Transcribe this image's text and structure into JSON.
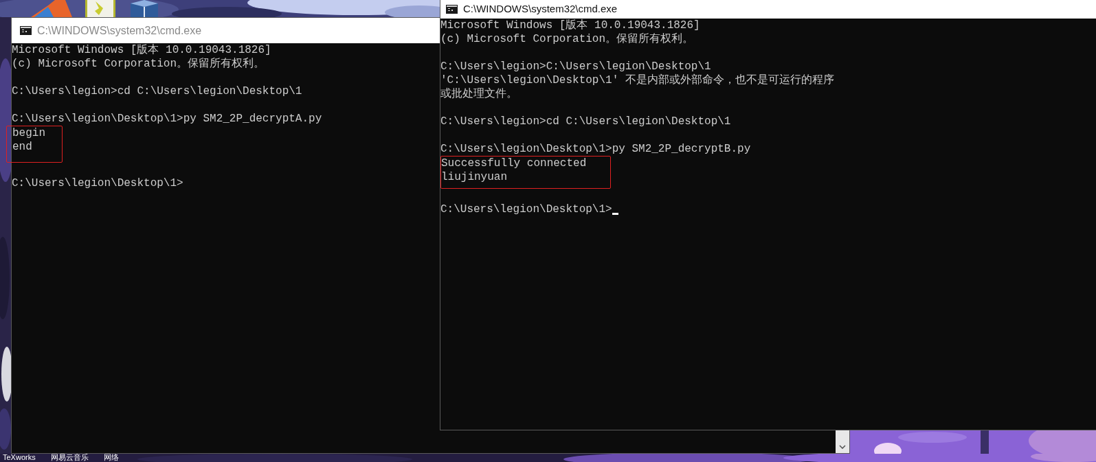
{
  "desktop": {
    "icon_labels": [
      "TeXworks",
      "网易云音乐",
      "网络"
    ]
  },
  "left_window": {
    "title": "C:\\WINDOWS\\system32\\cmd.exe",
    "active": false,
    "paragraphs": [
      [
        {
          "text": "Microsoft Windows [版本 10.0.19043.1826]",
          "highlighted": false
        },
        {
          "text": "(c) Microsoft Corporation。保留所有权利。",
          "highlighted": false
        }
      ],
      [
        {
          "text": "C:\\Users\\legion>cd C:\\Users\\legion\\Desktop\\1",
          "highlighted": false
        }
      ],
      [
        {
          "text": "C:\\Users\\legion\\Desktop\\1>py SM2_2P_decryptA.py",
          "highlighted": false
        },
        {
          "text": "begin",
          "highlighted": true
        },
        {
          "text": "end",
          "highlighted": true
        }
      ],
      [
        {
          "text": "C:\\Users\\legion\\Desktop\\1>",
          "highlighted": false
        }
      ]
    ]
  },
  "right_window": {
    "title": "C:\\WINDOWS\\system32\\cmd.exe",
    "active": true,
    "cursor": true,
    "paragraphs": [
      [
        {
          "text": "Microsoft Windows [版本 10.0.19043.1826]",
          "highlighted": false
        },
        {
          "text": "(c) Microsoft Corporation。保留所有权利。",
          "highlighted": false
        }
      ],
      [
        {
          "text": "C:\\Users\\legion>C:\\Users\\legion\\Desktop\\1",
          "highlighted": false
        },
        {
          "text": "'C:\\Users\\legion\\Desktop\\1' 不是内部或外部命令，也不是可运行的程序",
          "highlighted": false
        },
        {
          "text": "或批处理文件。",
          "highlighted": false
        }
      ],
      [
        {
          "text": "C:\\Users\\legion>cd C:\\Users\\legion\\Desktop\\1",
          "highlighted": false
        }
      ],
      [
        {
          "text": "C:\\Users\\legion\\Desktop\\1>py SM2_2P_decryptB.py",
          "highlighted": false
        },
        {
          "text": "Successfully connected",
          "highlighted": true
        },
        {
          "text": "liujinyuan",
          "highlighted": true
        }
      ],
      [
        {
          "text": "C:\\Users\\legion\\Desktop\\1>",
          "highlighted": false
        }
      ]
    ]
  }
}
